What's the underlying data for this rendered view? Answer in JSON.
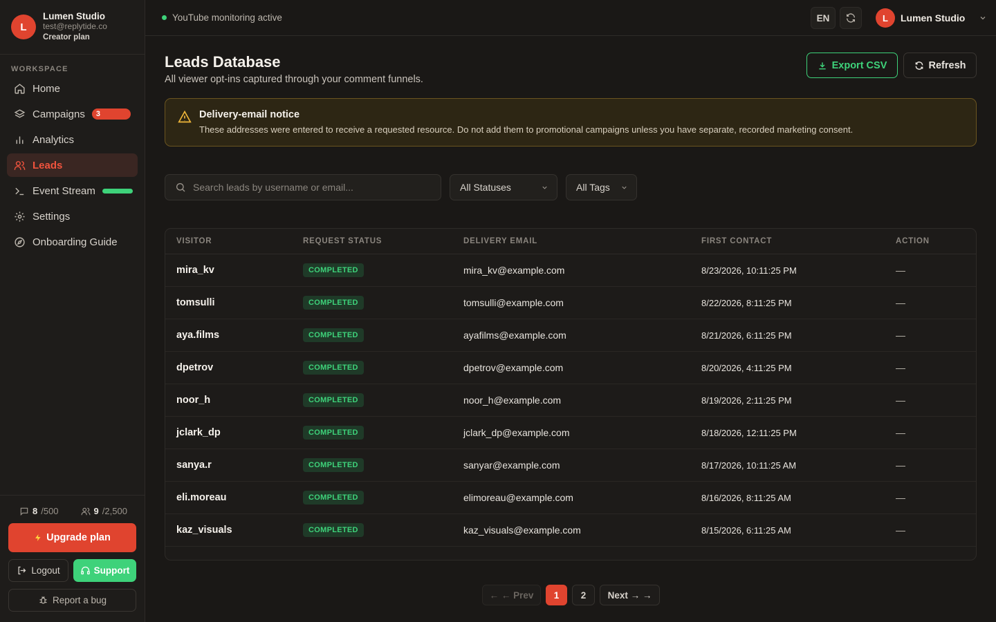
{
  "profile": {
    "initial": "L",
    "name": "Lumen Studio",
    "email": "test@replytide.co",
    "plan": "Creator plan"
  },
  "sidebar": {
    "section_label": "WORKSPACE",
    "items": [
      {
        "label": "Home",
        "icon": "home-icon"
      },
      {
        "label": "Campaigns",
        "icon": "layers-icon",
        "badge": "3"
      },
      {
        "label": "Analytics",
        "icon": "bar-chart-icon"
      },
      {
        "label": "Leads",
        "icon": "users-icon",
        "active": true
      },
      {
        "label": "Event Stream",
        "icon": "terminal-icon"
      },
      {
        "label": "Settings",
        "icon": "gear-icon"
      },
      {
        "label": "Onboarding Guide",
        "icon": "compass-icon"
      }
    ],
    "quota_comments": {
      "used": "8",
      "limit": "/500"
    },
    "quota_leads": {
      "used": "9",
      "limit": "/2,500"
    },
    "upgrade_label": "Upgrade plan",
    "logout_label": "Logout",
    "support_label": "Support",
    "bug_label": "Report a bug"
  },
  "topbar": {
    "monitor_status": "YouTube monitoring active",
    "language": "EN",
    "user_initial": "L",
    "user_name": "Lumen Studio"
  },
  "main": {
    "title": "Leads Database",
    "subtitle": "All viewer opt-ins captured through your comment funnels.",
    "export_label": "Export CSV",
    "refresh_label": "Refresh",
    "notice_title": "Delivery-email notice",
    "notice_text": "These addresses were entered to receive a requested resource. Do not add them to promotional campaigns unless you have separate, recorded marketing consent.",
    "search_placeholder": "Search leads by username or email...",
    "status_filter": "All Statuses",
    "tag_filter": "All Tags"
  },
  "table": {
    "headers": [
      "VISITOR",
      "REQUEST STATUS",
      "DELIVERY EMAIL",
      "FIRST CONTACT",
      "ACTION"
    ],
    "rows": [
      {
        "visitor": "mira_kv",
        "status": "COMPLETED",
        "email": "mira_kv@example.com",
        "date": "8/23/2026, 10:11:25 PM",
        "action": "—"
      },
      {
        "visitor": "tomsulli",
        "status": "COMPLETED",
        "email": "tomsulli@example.com",
        "date": "8/22/2026, 8:11:25 PM",
        "action": "—"
      },
      {
        "visitor": "aya.films",
        "status": "COMPLETED",
        "email": "ayafilms@example.com",
        "date": "8/21/2026, 6:11:25 PM",
        "action": "—"
      },
      {
        "visitor": "dpetrov",
        "status": "COMPLETED",
        "email": "dpetrov@example.com",
        "date": "8/20/2026, 4:11:25 PM",
        "action": "—"
      },
      {
        "visitor": "noor_h",
        "status": "COMPLETED",
        "email": "noor_h@example.com",
        "date": "8/19/2026, 2:11:25 PM",
        "action": "—"
      },
      {
        "visitor": "jclark_dp",
        "status": "COMPLETED",
        "email": "jclark_dp@example.com",
        "date": "8/18/2026, 12:11:25 PM",
        "action": "—"
      },
      {
        "visitor": "sanya.r",
        "status": "COMPLETED",
        "email": "sanyar@example.com",
        "date": "8/17/2026, 10:11:25 AM",
        "action": "—"
      },
      {
        "visitor": "eli.moreau",
        "status": "COMPLETED",
        "email": "elimoreau@example.com",
        "date": "8/16/2026, 8:11:25 AM",
        "action": "—"
      },
      {
        "visitor": "kaz_visuals",
        "status": "COMPLETED",
        "email": "kaz_visuals@example.com",
        "date": "8/15/2026, 6:11:25 AM",
        "action": "—"
      }
    ]
  },
  "pagination": {
    "prev": "← ← Prev",
    "pages": [
      "1",
      "2"
    ],
    "next": "Next → →"
  },
  "colors": {
    "accent": "#e0442f",
    "success": "#3ed27a",
    "bg": "#1a1816"
  }
}
